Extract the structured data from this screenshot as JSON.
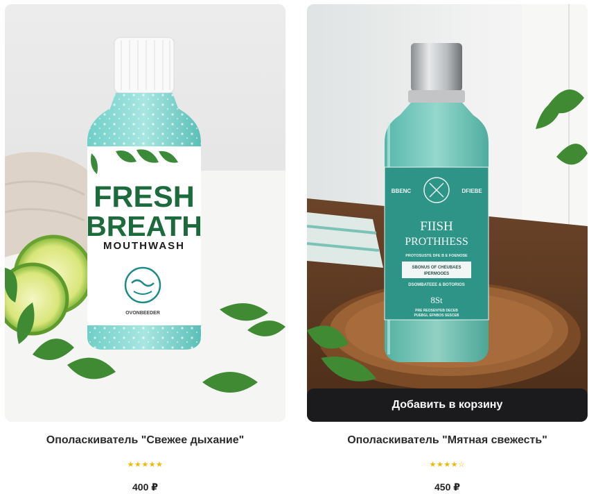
{
  "products": [
    {
      "title": "Ополаскиватель \"Свежее дыхание\"",
      "rating": 5,
      "rating_max": 5,
      "price": "400 ₽",
      "label": {
        "line1": "FRESH",
        "line2": "BREATH",
        "line3": "MOUTHWASH",
        "brand": "OVONBEEDER"
      }
    },
    {
      "title": "Ополаскиватель \"Мятная свежесть\"",
      "rating": 4,
      "rating_max": 5,
      "price": "450 ₽",
      "cart_button_label": "Добавить в корзину",
      "label": {
        "left_tag": "BBENC",
        "right_tag": "DFIEBE",
        "name_line1": "FIISH",
        "name_line2": "PROTHHESS",
        "sub_line": "PROTOSUSTE DFE B E FOENOSE",
        "box_line1": "SBONUS OF CHEUBAES",
        "box_line2": "IPERMOOES",
        "mid_line": "DSOMBATEEE & BOTORIOS",
        "volume": "8St",
        "foot_line1": "PRE REOSENTEB DECEB",
        "foot_line2": "PUEBGL EFNBOS SESCEB"
      }
    }
  ],
  "colors": {
    "accent_dark": "#1b1b1d",
    "star": "#f2b705",
    "label_teal": "#2f9488",
    "logo_green": "#1d6b3d"
  }
}
